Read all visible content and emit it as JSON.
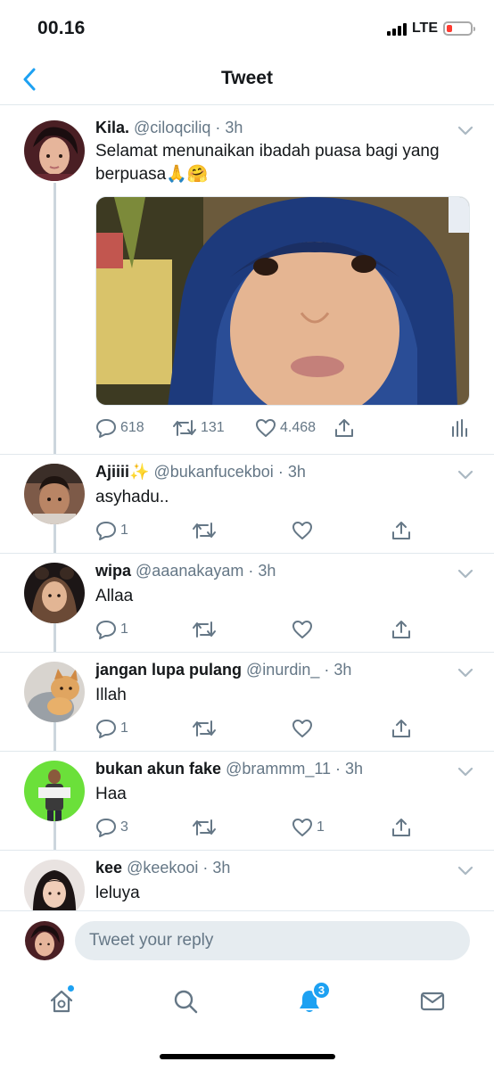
{
  "status_bar": {
    "time": "00.16",
    "network": "LTE",
    "battery_color": "#ff3b30"
  },
  "nav": {
    "title": "Tweet",
    "back_icon": "chevron-left-icon"
  },
  "colors": {
    "accent": "#1da1f2",
    "secondary_text": "#657786",
    "border": "#e1e8ed"
  },
  "main_tweet": {
    "name": "Kila.",
    "handle": "@ciloqciliq",
    "time": "3h",
    "text": "Selamat menunaikan ibadah puasa bagi yang berpuasa🙏🤗",
    "replies": "618",
    "retweets": "131",
    "likes": "4.468"
  },
  "replies": [
    {
      "name": "Ajiiii✨",
      "handle": "@bukanfucekboi",
      "time": "3h",
      "text": "asyhadu..",
      "reply_count": "1",
      "retweet_count": "",
      "like_count": ""
    },
    {
      "name": "wipa",
      "handle": "@aaanakayam",
      "time": "3h",
      "text": "Allaa",
      "reply_count": "1",
      "retweet_count": "",
      "like_count": ""
    },
    {
      "name": "jangan lupa pulang",
      "handle": "@inurdin_",
      "time": "3h",
      "text": "Illah",
      "reply_count": "1",
      "retweet_count": "",
      "like_count": ""
    },
    {
      "name": "bukan akun fake",
      "handle": "@brammm_11",
      "time": "3h",
      "text": "Haa",
      "reply_count": "3",
      "retweet_count": "",
      "like_count": "1"
    },
    {
      "name": "kee",
      "handle": "@keekooi",
      "time": "3h",
      "text": "leluya",
      "reply_count": "",
      "retweet_count": "",
      "like_count": ""
    }
  ],
  "composer": {
    "placeholder": "Tweet your reply"
  },
  "tab_bar": {
    "items": [
      {
        "icon": "home-icon",
        "has_dot": true
      },
      {
        "icon": "search-icon"
      },
      {
        "icon": "bell-icon",
        "badge": "3"
      },
      {
        "icon": "mail-icon"
      }
    ]
  }
}
